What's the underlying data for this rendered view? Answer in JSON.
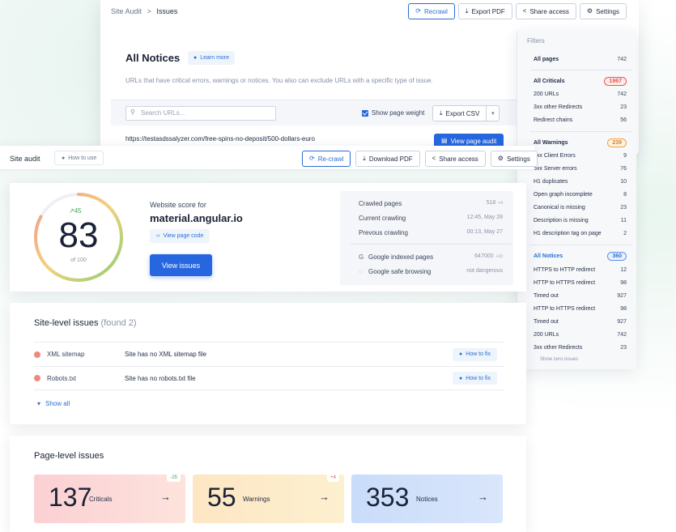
{
  "back": {
    "breadcrumb": {
      "root": "Site Audit",
      "sep": ">",
      "current": "Issues"
    },
    "actions": {
      "recrawl": "Recrawl",
      "export_pdf": "Export PDF",
      "share": "Share access",
      "settings": "Settings"
    },
    "title": "All Notices",
    "learn_more": "Learn more",
    "description": "URLs that have critical errors, warnings or notices. You also can exclude URLs with a specific type of issue.",
    "search": {
      "placeholder": "Search URLs..."
    },
    "show_page_weight": "Show page weight",
    "export_csv": "Export CSV",
    "url": "https://testasdssalyzer.com/free-spins-no-deposit/500-dollars-euro",
    "view_page_audit": "View page audit"
  },
  "filters": {
    "title": "Filters",
    "all_pages": {
      "label": "All pages",
      "count": "742"
    },
    "criticals": {
      "label": "All Criticals",
      "count": "1967",
      "items": [
        {
          "label": "200 URLs",
          "count": "742"
        },
        {
          "label": "3xx other Redirects",
          "count": "23"
        },
        {
          "label": "Redirect chains",
          "count": "56"
        }
      ]
    },
    "warnings": {
      "label": "All Warnings",
      "count": "239",
      "items": [
        {
          "label": "4xx Client Errors",
          "count": "9"
        },
        {
          "label": "5xx Server errors",
          "count": "76"
        },
        {
          "label": "H1 duplicates",
          "count": "10"
        },
        {
          "label": "Open graph incomplete",
          "count": "8"
        },
        {
          "label": "Canonical is missing",
          "count": "23"
        },
        {
          "label": "Description is missing",
          "count": "11"
        },
        {
          "label": "H1 description tag on page",
          "count": "2"
        }
      ]
    },
    "notices": {
      "label": "All Notices",
      "count": "360",
      "items": [
        {
          "label": "HTTPS to HTTP redirect",
          "count": "12"
        },
        {
          "label": "HTTP to HTTPS redirect",
          "count": "98"
        },
        {
          "label": "Timed out",
          "count": "927"
        },
        {
          "label": "HTTP to HTTPS redirect",
          "count": "98"
        },
        {
          "label": "Timed out",
          "count": "927"
        },
        {
          "label": "200 URLs",
          "count": "742"
        },
        {
          "label": "3xx other Redirects",
          "count": "23"
        }
      ]
    },
    "show_zero": "Show zero issues"
  },
  "front": {
    "title": "Site audit",
    "how_to_use": "How to use",
    "actions": {
      "recrawl": "Re-crawl",
      "download_pdf": "Download PDF",
      "share": "Share access",
      "settings": "Settings"
    }
  },
  "score": {
    "value": "83",
    "of": "of 100",
    "delta": "45",
    "label": "Website score for",
    "domain": "material.angular.io",
    "view_code": "View page code",
    "view_issues": "View issues",
    "stats": [
      {
        "label": "Crawled pages",
        "value": "518",
        "sub": "+4"
      },
      {
        "label": "Current crawling",
        "value": "12:45, May 28",
        "sub": ""
      },
      {
        "label": "Prevous crawling",
        "value": "00:13, May 27",
        "sub": ""
      }
    ],
    "google": [
      {
        "icon": "G",
        "label": "Google indexed pages",
        "value": "647000",
        "sub": "+10"
      },
      {
        "icon": "◌",
        "label": "Google safe browsing",
        "value": "not dangerous",
        "sub": ""
      }
    ]
  },
  "site_issues": {
    "title": "Site-level issues",
    "found": "(found 2)",
    "rows": [
      {
        "name": "XML sitemap",
        "desc": "Site has no XML sitemap file",
        "fix": "How to fix"
      },
      {
        "name": "Robots.txt",
        "desc": "Site has no robots.txt file",
        "fix": "How to fix"
      }
    ],
    "show_all": "Show all"
  },
  "page_issues": {
    "title": "Page-level issues",
    "tiles": [
      {
        "value": "137",
        "label": "Criticals",
        "badge": "-25",
        "badge_color": "#3aa655"
      },
      {
        "value": "55",
        "label": "Warnings",
        "badge": "+4",
        "badge_color": "#e7584f"
      },
      {
        "value": "353",
        "label": "Notices",
        "badge": "",
        "badge_color": ""
      }
    ]
  }
}
